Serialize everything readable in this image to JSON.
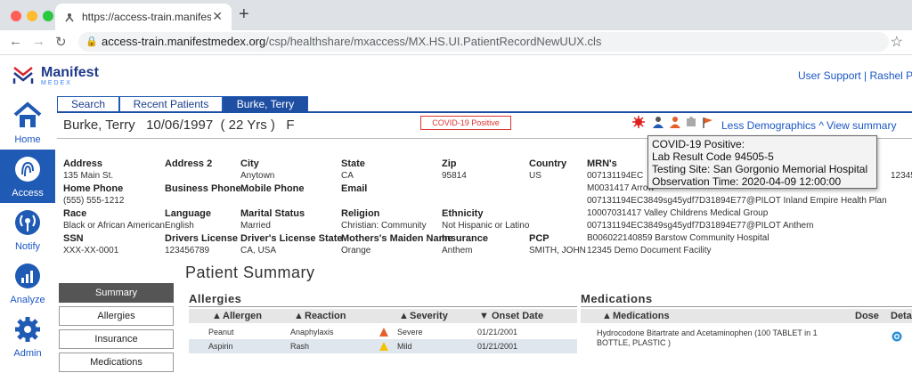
{
  "browser": {
    "tab_title": "https://access-train.manifestm",
    "url_host": "access-train.manifestmedex.org",
    "url_path": "/csp/healthshare/mxaccess/MX.HS.UI.PatientRecordNewUUX.cls"
  },
  "header": {
    "logo_name": "Manifest",
    "logo_sub": "MEDEX",
    "user_links": "User Support  |  Rashel P"
  },
  "sidebar": {
    "items": [
      {
        "label": "Home",
        "icon": "home-icon"
      },
      {
        "label": "Access",
        "icon": "fingerprint-icon"
      },
      {
        "label": "Notify",
        "icon": "broadcast-icon"
      },
      {
        "label": "Analyze",
        "icon": "chart-icon"
      },
      {
        "label": "Admin",
        "icon": "gear-icon"
      }
    ]
  },
  "tabs": [
    "Search",
    "Recent Patients",
    "Burke, Terry"
  ],
  "patient": {
    "banner": "Burke, Terry   10/06/1997  ( 22 Yrs )   F",
    "covid_badge": "COVID-19 Positive",
    "less_demographics": "Less Demographics ^",
    "view_summary": "View summary"
  },
  "demographics": {
    "address_label": "Address",
    "address": "135 Main St.",
    "address2_label": "Address 2",
    "city_label": "City",
    "city": "Anytown",
    "state_label": "State",
    "state": "CA",
    "zip_label": "Zip",
    "zip": "95814",
    "country_label": "Country",
    "country": "US",
    "mrn_label": "MRN's",
    "home_phone_label": "Home Phone",
    "home_phone": "(555) 555-1212",
    "business_phone_label": "Business Phone",
    "mobile_phone_label": "Mobile Phone",
    "email_label": "Email",
    "race_label": "Race",
    "race": "Black or African American",
    "language_label": "Language",
    "language": "English",
    "marital_label": "Marital Status",
    "marital": "Married",
    "religion_label": "Religion",
    "religion": "Christian: Community",
    "ethnicity_label": "Ethnicity",
    "ethnicity": "Not Hispanic or Latino",
    "ssn_label": "SSN",
    "ssn": "XXX-XX-0001",
    "dl_label": "Drivers License",
    "dl": "123456789",
    "dls_label": "Driver's License State",
    "dls": "CA, USA",
    "maiden_label": "Mothers's Maiden Name",
    "maiden": "Orange",
    "insurance_label": "Insurance",
    "insurance": "Anthem",
    "pcp_label": "PCP",
    "pcp": "SMITH, JOHN",
    "mrns": [
      "007131194EC",
      "M0031417 Arrow",
      "007131194EC3849sg45ydf7D31894E77@PILOT Inland Empire Health Plan",
      "10007031417 Valley Childrens Medical Group",
      "007131194EC3849sg45ydf7D31894E77@PILOT Anthem",
      "B006022140859 Barstow Community Hospital",
      "12345 Demo Document Facility"
    ],
    "right_edge_value": "12345"
  },
  "tooltip": {
    "lines": [
      "COVID-19 Positive:",
      "Lab Result Code 94505-5",
      "Testing Site: San Gorgonio Memorial Hospital",
      "Observation Time: 2020-04-09 12:00:00"
    ]
  },
  "summary": {
    "title": "Patient Summary",
    "nav": [
      "Summary",
      "Allergies",
      "Insurance",
      "Medications"
    ],
    "allergies_title": "Allergies",
    "allergy_headers": [
      "Allergen",
      "Reaction",
      "Severity",
      "Onset Date"
    ],
    "allergies": [
      {
        "allergen": "Peanut",
        "reaction": "Anaphylaxis",
        "severity": "Severe",
        "onset": "01/21/2001"
      },
      {
        "allergen": "Aspirin",
        "reaction": "Rash",
        "severity": "Mild",
        "onset": "01/21/2001"
      }
    ],
    "medications_title": "Medications",
    "med_headers": [
      "Medications",
      "Dose",
      "Deta"
    ],
    "medications": [
      {
        "line1": "Hydrocodone Bitartrate and Acetaminophen (100 TABLET in 1",
        "line2": "BOTTLE, PLASTIC )"
      }
    ]
  },
  "colors": {
    "brand": "#1f5ab4",
    "alert": "#dd3333",
    "warn": "#f2c200"
  }
}
